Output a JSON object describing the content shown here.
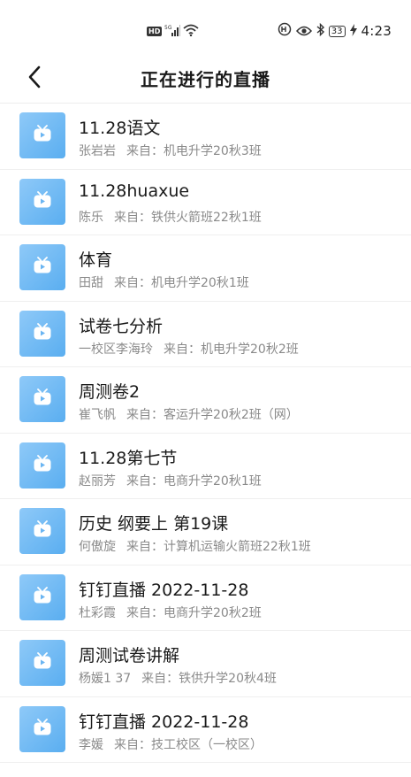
{
  "status_bar": {
    "hd": "HD",
    "network": "5G",
    "battery": "33",
    "time": "4:23"
  },
  "header": {
    "back_icon": "chevron-left-icon",
    "title": "正在进行的直播"
  },
  "colors": {
    "thumb_start": "#8ec9f8",
    "thumb_end": "#5aaef0",
    "meta_text": "#8a8a8a"
  },
  "from_prefix": "来自：",
  "items": [
    {
      "title": "11.28语文",
      "teacher": "张岩岩",
      "from_label": "来自：",
      "class_name": "机电升学20秋3班"
    },
    {
      "title": "11.28huaxue",
      "teacher": "陈乐",
      "from_label": "来自：",
      "class_name": "铁供火箭班22秋1班"
    },
    {
      "title": "体育",
      "teacher": "田甜",
      "from_label": "来自：",
      "class_name": "机电升学20秋1班"
    },
    {
      "title": "试卷七分析",
      "teacher": "一校区李海玲",
      "from_label": "来自：",
      "class_name": "机电升学20秋2班"
    },
    {
      "title": "周测卷2",
      "teacher": "崔飞帆",
      "from_label": "来自：",
      "class_name": "客运升学20秋2班（网）"
    },
    {
      "title": "11.28第七节",
      "teacher": "赵丽芳",
      "from_label": "来自：",
      "class_name": "电商升学20秋1班"
    },
    {
      "title": "历史 纲要上 第19课",
      "teacher": "何傲旋",
      "from_label": "来自：",
      "class_name": "计算机运输火箭班22秋1班"
    },
    {
      "title": "钉钉直播 2022-11-28",
      "teacher": "杜彩霞",
      "from_label": "来自：",
      "class_name": "电商升学20秋2班"
    },
    {
      "title": "周测试卷讲解",
      "teacher": "杨媛1     37",
      "from_label": "来自：",
      "class_name": "铁供升学20秋4班"
    },
    {
      "title": "钉钉直播 2022-11-28",
      "teacher": "李媛",
      "from_label": "来自：",
      "class_name": "技工校区（一校区）"
    }
  ]
}
